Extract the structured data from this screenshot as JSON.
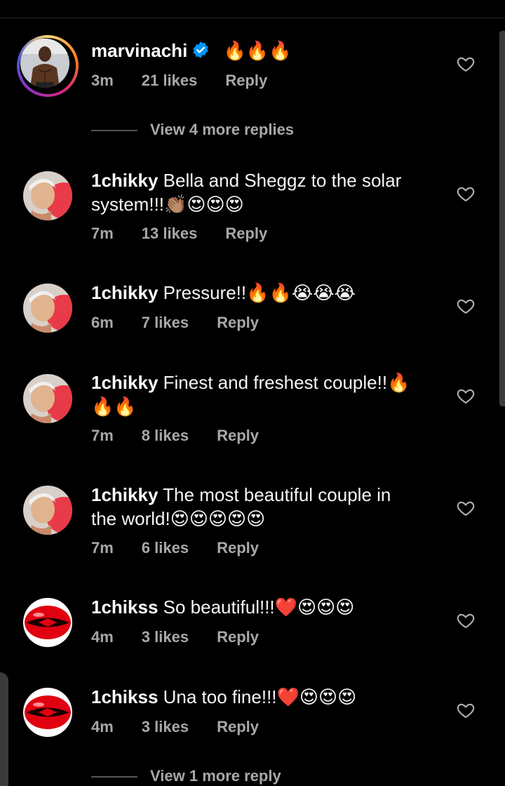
{
  "comments": [
    {
      "username": "marvinachi",
      "verified": true,
      "text": "🔥🔥🔥",
      "time": "3m",
      "likes": "21 likes",
      "reply": "Reply"
    },
    {
      "username": "1chikky",
      "text": "Bella and Sheggz to the solar system!!!👏🏽😍😍😍",
      "time": "7m",
      "likes": "13 likes",
      "reply": "Reply"
    },
    {
      "username": "1chikky",
      "text": "Pressure!!🔥🔥😭😭😭",
      "time": "6m",
      "likes": "7 likes",
      "reply": "Reply"
    },
    {
      "username": "1chikky",
      "text": "Finest and freshest couple!!🔥🔥🔥",
      "time": "7m",
      "likes": "8 likes",
      "reply": "Reply"
    },
    {
      "username": "1chikky",
      "text": "The most beautiful couple in the world!😍😍😍😍😍",
      "time": "7m",
      "likes": "6 likes",
      "reply": "Reply"
    },
    {
      "username": "1chikss",
      "text": "So beautiful!!!❤️😍😍😍",
      "time": "4m",
      "likes": "3 likes",
      "reply": "Reply"
    },
    {
      "username": "1chikss",
      "text": "Una too fine!!!❤️😍😍😍",
      "time": "4m",
      "likes": "3 likes",
      "reply": "Reply"
    }
  ],
  "view_more_replies_1": "View 4 more replies",
  "view_more_replies_2": "View 1 more reply",
  "colors": {
    "background": "#000000",
    "secondary_text": "#a8a8a8",
    "verified_badge": "#0095f6",
    "heart_red": "#ed4956"
  }
}
